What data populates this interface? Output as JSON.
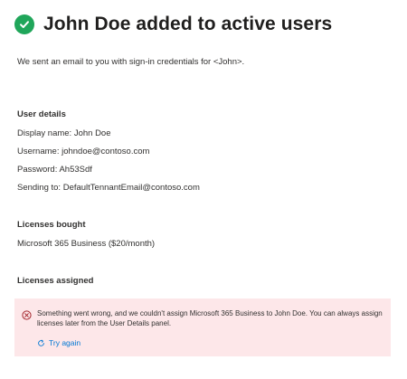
{
  "header": {
    "title": "John Doe added to active users",
    "subtitle": "We sent an email to you with sign-in credentials for <John>.",
    "success_icon": "checkmark-circle-icon"
  },
  "user_details": {
    "heading": "User details",
    "display_name": "Display name: John Doe",
    "username": "Username: johndoe@contoso.com",
    "password": "Password: Ah53Sdf",
    "sending_to": "Sending to: DefaultTennantEmail@contoso.com"
  },
  "licenses_bought": {
    "heading": "Licenses bought",
    "value": "Microsoft 365 Business ($20/month)"
  },
  "licenses_assigned": {
    "heading": "Licenses assigned",
    "error_message": "Something went wrong, and we couldn't assign Microsoft 365 Business to John Doe. You can always assign licenses later from the User Details panel.",
    "error_icon": "error-circle-icon",
    "retry_label": "Try again",
    "retry_icon": "refresh-icon"
  },
  "colors": {
    "success": "#20a65a",
    "error_background": "#fde7e9",
    "error_icon": "#a4262c",
    "link": "#0078d4"
  }
}
